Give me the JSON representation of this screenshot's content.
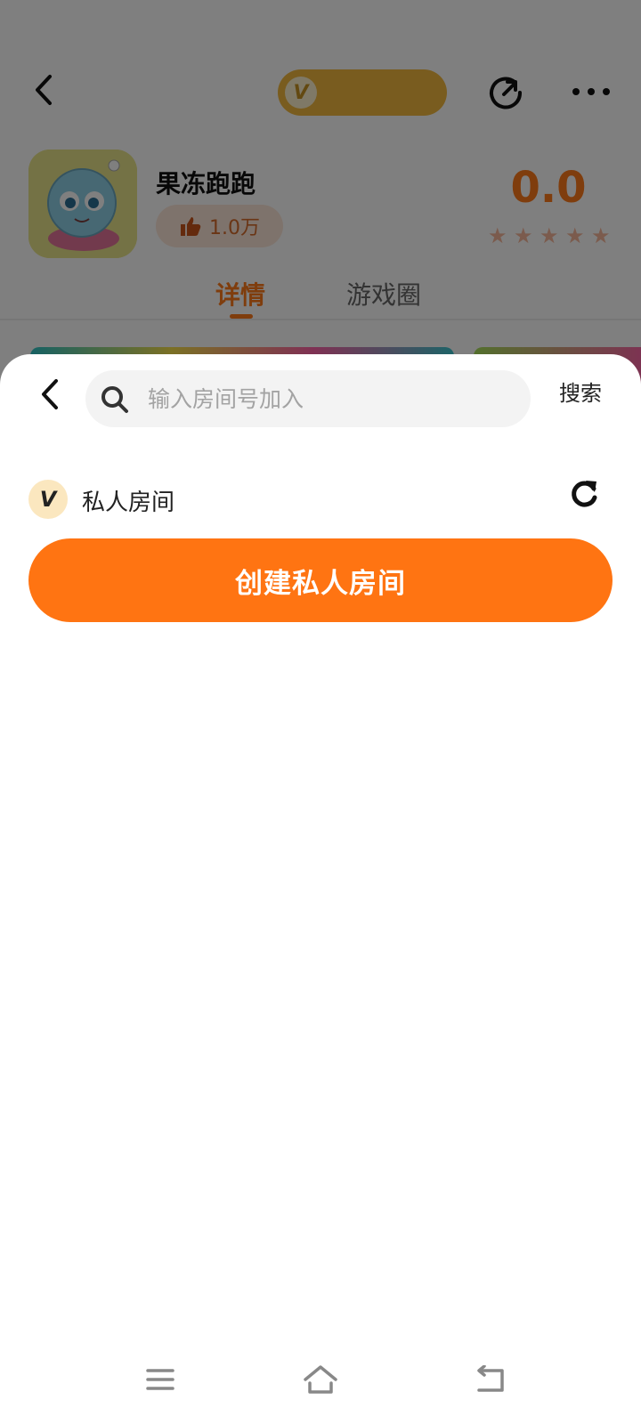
{
  "background_page": {
    "app_name": "果冻跑跑",
    "likes": "1.0万",
    "rating": "0.0",
    "stars": [
      "★",
      "★",
      "★",
      "★",
      "★"
    ],
    "vip_badge": "V",
    "tabs": [
      {
        "label": "详情",
        "active": true
      },
      {
        "label": "游戏圈",
        "active": false
      }
    ],
    "accent_color": "#ff7a1a"
  },
  "sheet": {
    "search": {
      "placeholder": "输入房间号加入",
      "value": "",
      "button_label": "搜索"
    },
    "private_room": {
      "badge": "V",
      "title": "私人房间"
    },
    "create_button_label": "创建私人房间",
    "create_button_color": "#ff7412"
  },
  "icons": {
    "back": "chevron-left-icon",
    "search": "search-icon",
    "refresh": "refresh-icon",
    "share": "share-icon",
    "more": "more-icon",
    "nav_menu": "menu-icon",
    "nav_home": "home-icon",
    "nav_back": "back-icon"
  }
}
